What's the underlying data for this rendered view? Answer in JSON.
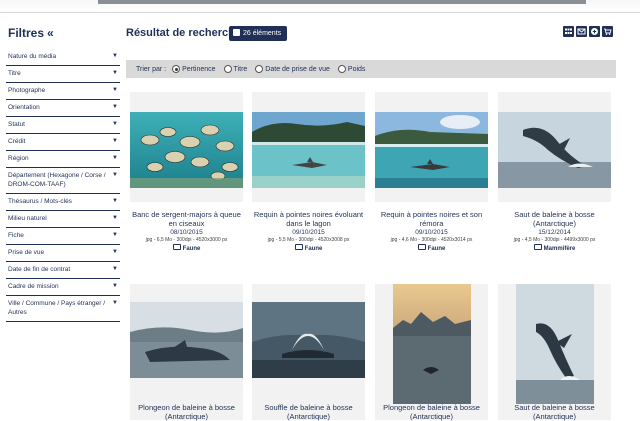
{
  "sidebar": {
    "title": "Filtres",
    "collapse_glyph": "«",
    "filters": [
      {
        "label": "Nature du média"
      },
      {
        "label": "Titre"
      },
      {
        "label": "Photographe"
      },
      {
        "label": "Orientation"
      },
      {
        "label": "Statut"
      },
      {
        "label": "Crédit"
      },
      {
        "label": "Région"
      },
      {
        "label": "Département (Hexagone / Corse / DROM-COM-TAAF)"
      },
      {
        "label": "Thésaurus / Mots-clés"
      },
      {
        "label": "Milieu naturel"
      },
      {
        "label": "Fiche"
      },
      {
        "label": "Prise de vue"
      },
      {
        "label": "Date de fin de contrat"
      },
      {
        "label": "Cadre de mission"
      },
      {
        "label": "Ville / Commune / Pays étranger / Autres"
      }
    ],
    "caret_glyph": "▼"
  },
  "main": {
    "title": "Résultat de recherche",
    "count": "26 éléments",
    "toolbar_icons": [
      "grid-view-icon",
      "envelope-icon",
      "plus-circle-icon",
      "cart-icon"
    ],
    "sort": {
      "label": "Trier par :",
      "options": [
        "Pertinence",
        "Titre",
        "Date de prise de vue",
        "Poids"
      ],
      "selected": "Pertinence"
    }
  },
  "results": [
    {
      "title": "Banc de sergent-majors à queue en ciseaux",
      "date": "08/10/2015",
      "meta": "jpg - 6,5 Mo - 300dpi - 4520x3000 px",
      "category": "Faune"
    },
    {
      "title": "Requin à pointes noires évoluant dans le lagon",
      "date": "09/10/2015",
      "meta": "jpg - 5,5 Mo - 300dpi - 4520x3008 px",
      "category": "Faune"
    },
    {
      "title": "Requin à pointes noires et son rémora",
      "date": "09/10/2015",
      "meta": "jpg - 4,6 Mo - 300dpi - 4520x3014 px",
      "category": "Faune"
    },
    {
      "title": "Saut de baleine à bosse (Antarctique)",
      "date": "15/12/2014",
      "meta": "jpg - 4,5 Mo - 300dpi - 4499x3000 px",
      "category": "Mammifère"
    },
    {
      "title": "Plongeon de baleine à bosse (Antarctique)"
    },
    {
      "title": "Souffle de baleine à bosse (Antarctique)"
    },
    {
      "title": "Plongeon de baleine à bosse (Antarctique)"
    },
    {
      "title": "Saut de baleine à bosse (Antarctique)"
    }
  ]
}
